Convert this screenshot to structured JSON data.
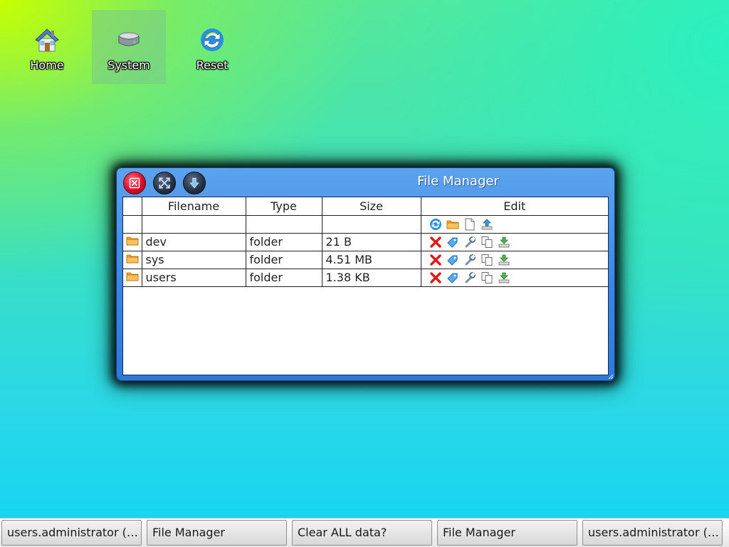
{
  "desktop": {
    "icons": [
      {
        "label": "Home",
        "icon": "home-icon"
      },
      {
        "label": "System",
        "icon": "drive-icon",
        "selected": true
      },
      {
        "label": "Reset",
        "icon": "refresh-icon"
      }
    ]
  },
  "window": {
    "title": "File Manager",
    "controls": [
      "close-icon",
      "maximize-icon",
      "minimize-icon"
    ],
    "columns": [
      "Filename",
      "Type",
      "Size",
      "Edit"
    ],
    "toolbar_icons": [
      "refresh-icon",
      "new-folder-icon",
      "new-file-icon",
      "upload-icon"
    ],
    "rows": [
      {
        "name": "dev",
        "type": "folder",
        "size": "21 B"
      },
      {
        "name": "sys",
        "type": "folder",
        "size": "4.51 MB"
      },
      {
        "name": "users",
        "type": "folder",
        "size": "1.38 KB"
      }
    ],
    "row_actions": [
      "delete-icon",
      "rename-icon",
      "properties-icon",
      "copy-icon",
      "download-icon"
    ]
  },
  "taskbar": {
    "items": [
      "users.administrator (File Manager)",
      "File Manager",
      "Clear ALL data?",
      "File Manager",
      "users.administrator (File Manager)"
    ]
  },
  "colors": {
    "window_title_bar": "#3c86e2",
    "close_button": "#d8102b",
    "folder": "#f4a628",
    "delete": "#e01818"
  }
}
